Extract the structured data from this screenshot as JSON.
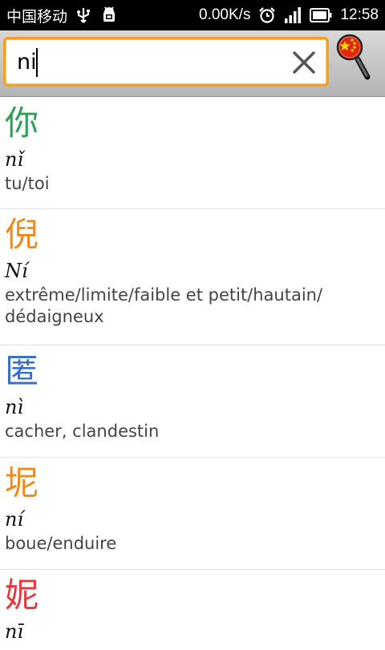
{
  "status_bar": {
    "carrier": "中国移动",
    "speed": "0.00K/s",
    "time": "12:58",
    "icons": [
      "usb-icon",
      "android-debug-icon",
      "alarm-icon",
      "signal-icon",
      "battery-icon"
    ]
  },
  "search": {
    "value": "ni",
    "clear_icon": "close-icon",
    "search_icon": "china-flag-magnifier-icon",
    "accent_color": "#f5a021"
  },
  "results": [
    {
      "hanzi": "你",
      "pinyin": "nǐ",
      "meaning": "tu/toi",
      "color": "#2e9e5a"
    },
    {
      "hanzi": "倪",
      "pinyin": "Ní",
      "meaning": "extrême/limite/faible et petit/hautain/",
      "meaning2": "dédaigneux",
      "color": "#ef8a1c"
    },
    {
      "hanzi": "匿",
      "pinyin": "nì",
      "meaning": "cacher, clandestin",
      "color": "#3a6fce"
    },
    {
      "hanzi": "坭",
      "pinyin": "ní",
      "meaning": "boue/enduire",
      "color": "#ef8a1c"
    },
    {
      "hanzi": "妮",
      "pinyin": "nī",
      "meaning": "",
      "color": "#e23a3a"
    }
  ]
}
